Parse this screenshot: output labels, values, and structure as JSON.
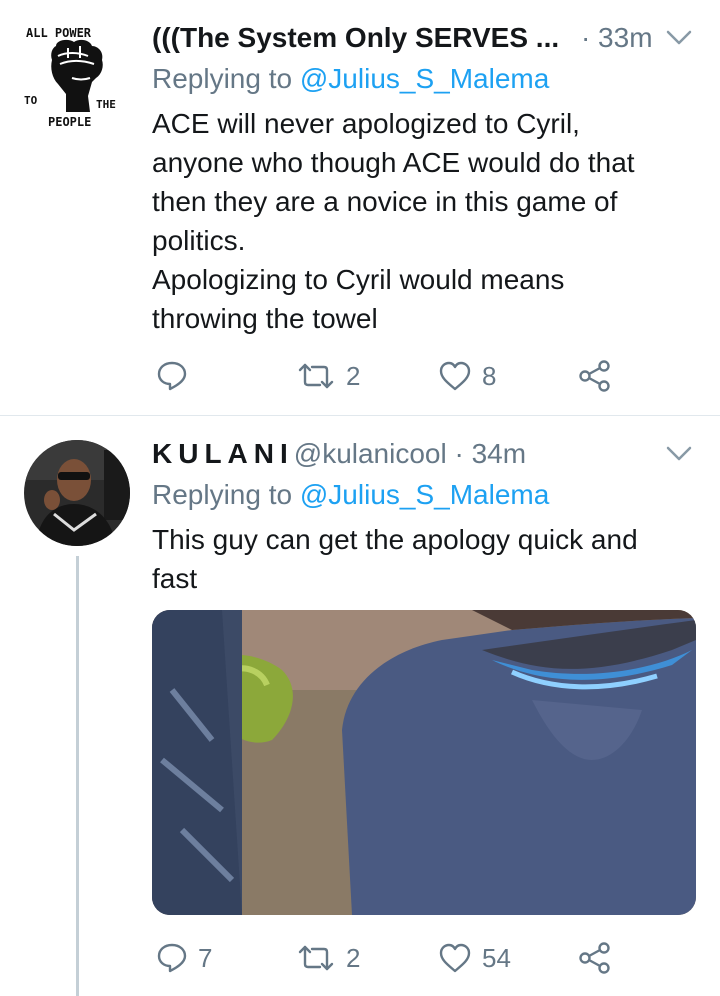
{
  "tweets": [
    {
      "display_name": "(((The System Only SERVES ...",
      "dot": "·",
      "time": "33m",
      "replying_prefix": "Replying to",
      "replying_to": "@Julius_S_Malema",
      "text_lines": [
        "ACE will never apologized to Cyril,",
        "anyone who though ACE would do that",
        "then they are a novice in this game of",
        "politics.",
        "Apologizing to Cyril would means",
        "throwing the towel"
      ],
      "avatar_text": {
        "line1": "ALL POWER",
        "line2_left": "TO",
        "line2_right": "THE",
        "line3": "PEOPLE"
      },
      "replies": "",
      "retweets": "2",
      "likes": "8"
    },
    {
      "display_name": "KULANI",
      "handle": "@kulanicool",
      "dot": "·",
      "time": "34m",
      "replying_prefix": "Replying to",
      "replying_to": "@Julius_S_Malema",
      "text_lines": [
        "This guy can get the apology quick and",
        "fast"
      ],
      "replies": "7",
      "retweets": "2",
      "likes": "54"
    }
  ],
  "colors": {
    "primary_text": "#14171a",
    "secondary_text": "#657786",
    "link": "#1da1f2",
    "divider": "#e1e8ed",
    "thread_line": "#c4cfd6"
  },
  "icons": {
    "reply": "reply-icon",
    "retweet": "retweet-icon",
    "like": "heart-icon",
    "share": "share-icon",
    "more": "chevron-down-icon"
  }
}
